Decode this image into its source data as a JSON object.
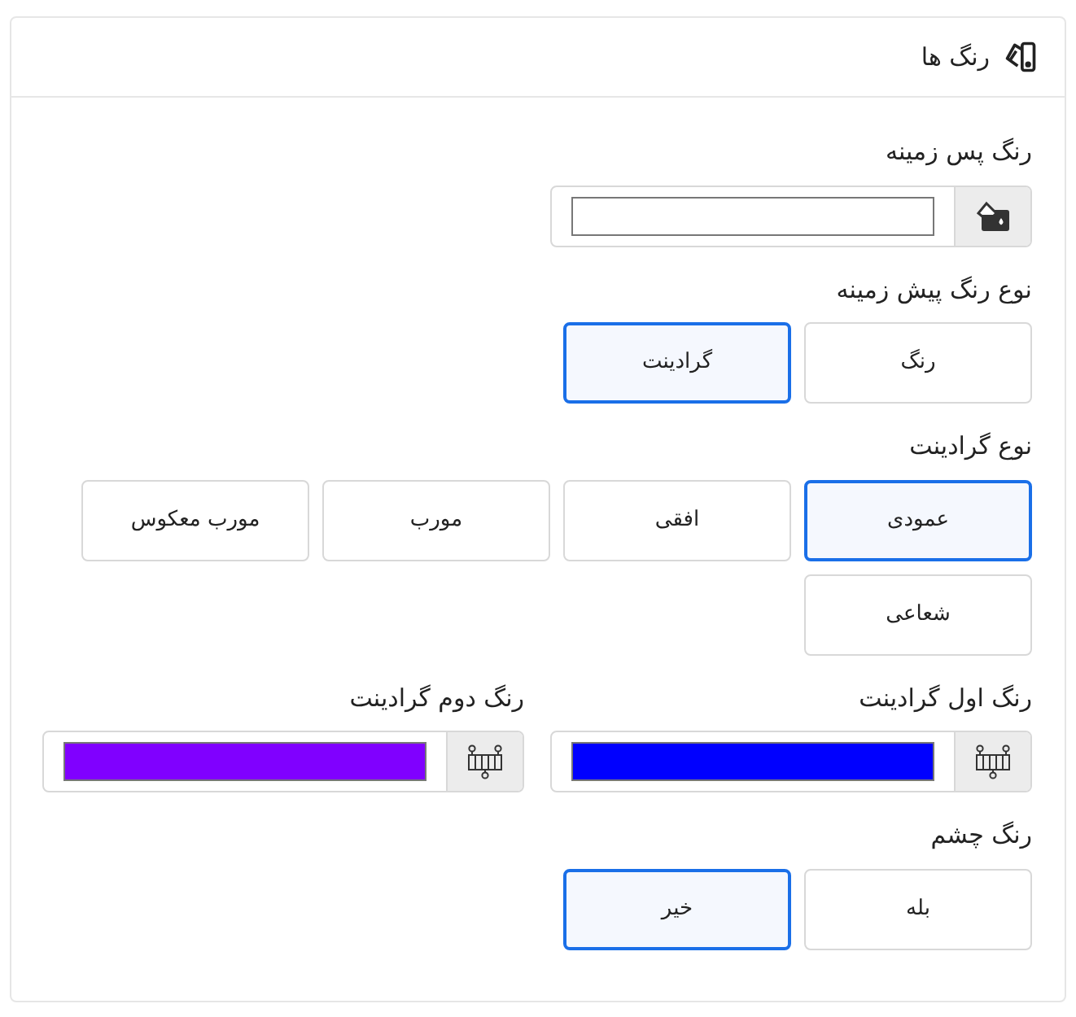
{
  "header": {
    "title": "رنگ ها"
  },
  "sections": [
    {
      "kind": "color",
      "label": "رنگ پس زمینه",
      "color": "#ffffff"
    },
    {
      "kind": "options",
      "label": "نوع رنگ پیش زمینه",
      "options": [
        {
          "label": "رنگ",
          "selected": false
        },
        {
          "label": "گرادینت",
          "selected": true
        }
      ]
    },
    {
      "kind": "options",
      "label": "نوع گرادینت",
      "options": [
        {
          "label": "عمودی",
          "selected": true
        },
        {
          "label": "افقی",
          "selected": false
        },
        {
          "label": "مورب",
          "selected": false
        },
        {
          "label": "مورب معکوس",
          "selected": false
        },
        {
          "label": "شعاعی",
          "selected": false
        }
      ]
    },
    {
      "kind": "color_pair",
      "items": [
        {
          "label": "رنگ اول گرادینت",
          "color": "#0000ff"
        },
        {
          "label": "رنگ دوم گرادینت",
          "color": "#8000ff"
        }
      ]
    },
    {
      "kind": "options",
      "label": "رنگ چشم",
      "options": [
        {
          "label": "بله",
          "selected": false
        },
        {
          "label": "خیر",
          "selected": true
        }
      ]
    }
  ]
}
